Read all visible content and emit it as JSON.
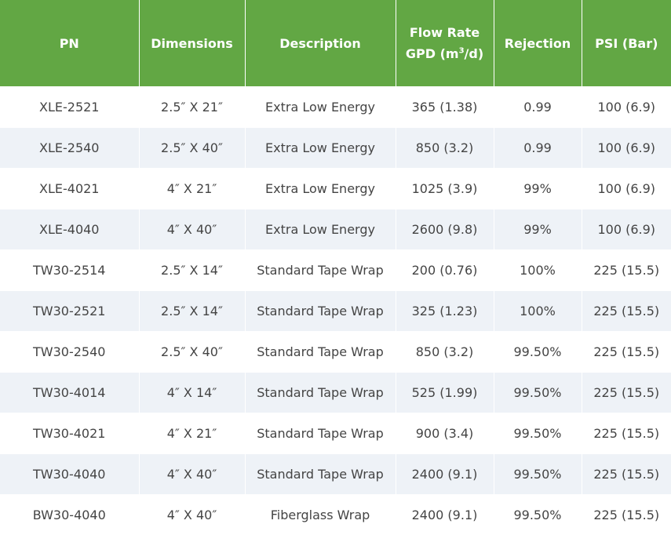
{
  "headers": {
    "pn": "PN",
    "dimensions": "Dimensions",
    "description": "Description",
    "flow_line1": "Flow Rate",
    "flow_line2_pre": "GPD (m",
    "flow_sup": "3",
    "flow_line2_post": "/d)",
    "rejection": "Rejection",
    "psi": "PSI (Bar)"
  },
  "rows": [
    {
      "pn": "XLE-2521",
      "dim": "2.5″ X 21″",
      "desc": "Extra Low Energy",
      "flow": "365 (1.38)",
      "rej": "0.99",
      "psi": "100 (6.9)"
    },
    {
      "pn": "XLE-2540",
      "dim": "2.5″ X 40″",
      "desc": "Extra Low Energy",
      "flow": "850 (3.2)",
      "rej": "0.99",
      "psi": "100 (6.9)"
    },
    {
      "pn": "XLE-4021",
      "dim": "4″ X 21″",
      "desc": "Extra Low Energy",
      "flow": "1025 (3.9)",
      "rej": "99%",
      "psi": "100 (6.9)"
    },
    {
      "pn": "XLE-4040",
      "dim": "4″ X 40″",
      "desc": "Extra Low Energy",
      "flow": "2600 (9.8)",
      "rej": "99%",
      "psi": "100 (6.9)"
    },
    {
      "pn": "TW30-2514",
      "dim": "2.5″ X 14″",
      "desc": "Standard Tape Wrap",
      "flow": "200 (0.76)",
      "rej": "100%",
      "psi": "225 (15.5)"
    },
    {
      "pn": "TW30-2521",
      "dim": "2.5″ X 14″",
      "desc": "Standard Tape Wrap",
      "flow": "325 (1.23)",
      "rej": "100%",
      "psi": "225 (15.5)"
    },
    {
      "pn": "TW30-2540",
      "dim": "2.5″ X 40″",
      "desc": "Standard Tape Wrap",
      "flow": "850 (3.2)",
      "rej": "99.50%",
      "psi": "225 (15.5)"
    },
    {
      "pn": "TW30-4014",
      "dim": "4″ X 14″",
      "desc": "Standard Tape Wrap",
      "flow": "525 (1.99)",
      "rej": "99.50%",
      "psi": "225 (15.5)"
    },
    {
      "pn": "TW30-4021",
      "dim": "4″ X 21″",
      "desc": "Standard Tape Wrap",
      "flow": "900 (3.4)",
      "rej": "99.50%",
      "psi": "225 (15.5)"
    },
    {
      "pn": "TW30-4040",
      "dim": "4″ X 40″",
      "desc": "Standard Tape Wrap",
      "flow": "2400 (9.1)",
      "rej": "99.50%",
      "psi": "225 (15.5)"
    },
    {
      "pn": "BW30-4040",
      "dim": "4″ X 40″",
      "desc": "Fiberglass Wrap",
      "flow": "2400 (9.1)",
      "rej": "99.50%",
      "psi": "225 (15.5)"
    }
  ],
  "colors": {
    "header_bg": "#62a744",
    "header_text": "#ffffff",
    "row_alt_bg": "#eef2f7",
    "cell_text": "#444444"
  }
}
